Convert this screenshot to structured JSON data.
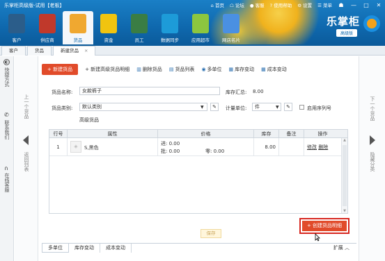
{
  "window": {
    "title": "乐掌柜高级版-试用【老板】"
  },
  "topbar": {
    "home": "首页",
    "forum": "论坛",
    "service": "客服",
    "help": "使用帮助",
    "settings": "设置",
    "menu": "菜单"
  },
  "nav": [
    {
      "label": "客户",
      "icon": "customer-icon",
      "color": "#2b5d8a"
    },
    {
      "label": "供应商",
      "icon": "supplier-icon",
      "color": "#c0392b"
    },
    {
      "label": "货品",
      "icon": "goods-icon",
      "color": "#f0a830"
    },
    {
      "label": "资金",
      "icon": "money-icon",
      "color": "#f1c40f"
    },
    {
      "label": "员工",
      "icon": "staff-icon",
      "color": "#3a7d44"
    },
    {
      "label": "数据同步",
      "icon": "sync-icon",
      "color": "#1d9bd8"
    },
    {
      "label": "应用超市",
      "icon": "app-store-icon",
      "color": "#8cc63f"
    },
    {
      "label": "网店名片",
      "icon": "card-icon",
      "color": "#4a90e2"
    }
  ],
  "brand": {
    "name": "乐掌柜",
    "edition": "高级版"
  },
  "tabs": [
    "客户",
    "货品",
    "新建货品"
  ],
  "left_sidebar": {
    "shortcuts": "快捷方式",
    "contact": "联系我们",
    "support": "在线客服"
  },
  "left_nav": {
    "prev": "上一个货品",
    "back": "返回列表"
  },
  "right_nav": {
    "next": "下一个货品",
    "hide": "隐藏分类"
  },
  "toolbar": {
    "new_goods": "+ 新建货品",
    "new_advanced": "+ 新建高级货品明细",
    "delete": "删除货品",
    "list": "货品列表",
    "multi_unit": "多单位",
    "stock_change": "库存变动",
    "cost_change": "成本变动"
  },
  "form": {
    "name_label": "货品名称:",
    "name_value": "女款裤子",
    "stock_label": "库存汇总:",
    "stock_value": "8.00",
    "category_label": "货品类别:",
    "category_value": "默认类别",
    "unit_label": "计量单位:",
    "unit_value": "件",
    "serial_label": "启用序列号",
    "advanced_label": "高级货品"
  },
  "table": {
    "headers": [
      "行号",
      "属性",
      "价格",
      "库存",
      "备注",
      "操作"
    ],
    "rows": [
      {
        "no": "1",
        "attr": "S,黑色",
        "price_in": "进: 0.00",
        "price_wholesale": "批: 0.00",
        "price_retail": "零: 0.00",
        "stock": "8.00",
        "note": "",
        "edit": "修改",
        "del": "删除"
      }
    ]
  },
  "create_button": "+ 创建货品明细",
  "ghost_button": "保存",
  "bottom_tabs": [
    "多单位",
    "库存变动",
    "成本变动"
  ],
  "expand": "扩展"
}
